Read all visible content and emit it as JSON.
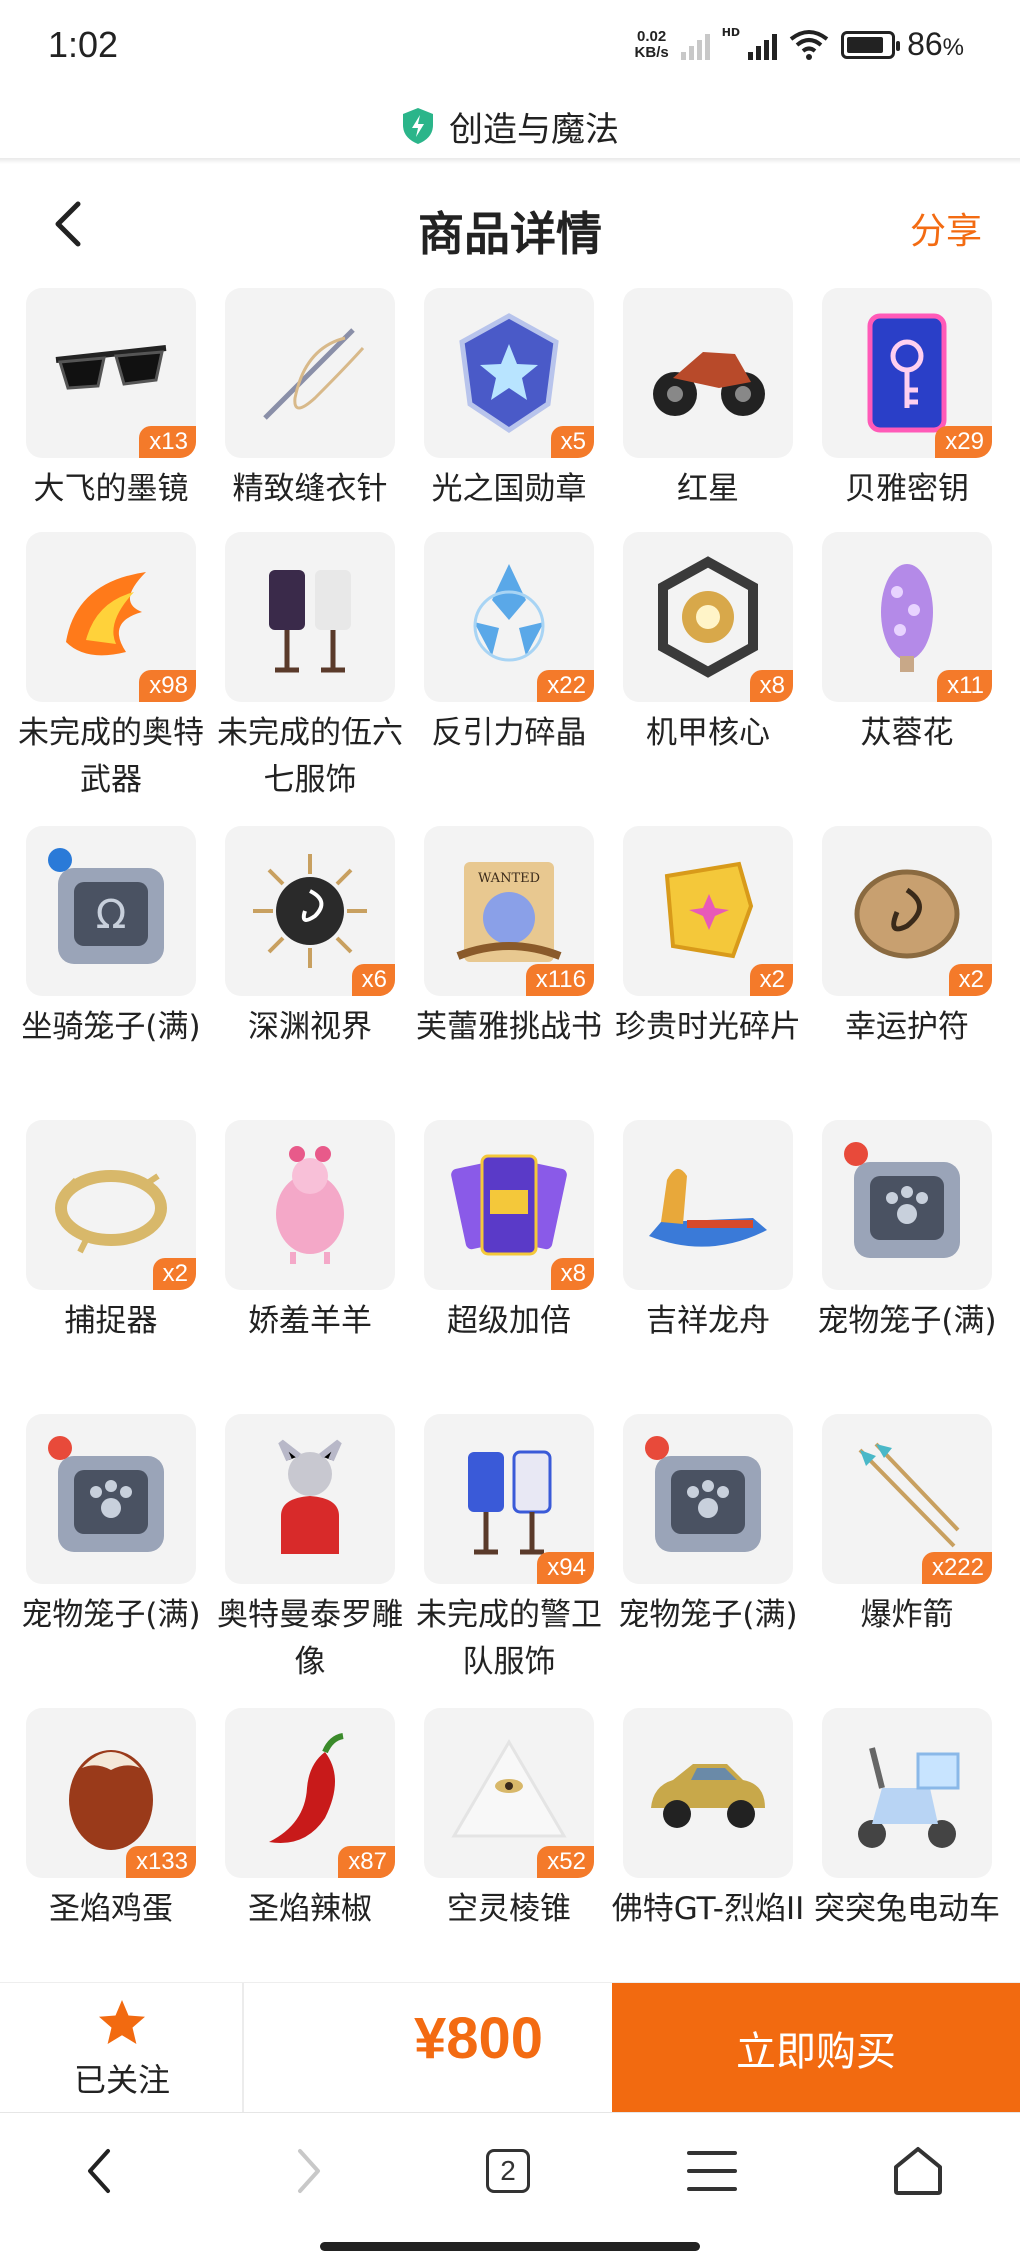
{
  "status_bar": {
    "time": "1:02",
    "net_speed": "0.02",
    "net_unit": "KB/s",
    "hd_label": "HD",
    "battery_percent": "86",
    "battery_suffix": "%"
  },
  "app": {
    "title": "创造与魔法"
  },
  "header": {
    "title": "商品详情",
    "share_label": "分享"
  },
  "items": [
    {
      "name": "大飞的墨镜",
      "qty": "x13",
      "icon": "sunglasses-icon"
    },
    {
      "name": "精致缝衣针",
      "qty": "",
      "icon": "needle-icon"
    },
    {
      "name": "光之国勋章",
      "qty": "x5",
      "icon": "medal-icon"
    },
    {
      "name": "红星",
      "qty": "",
      "icon": "motorcycle-icon"
    },
    {
      "name": "贝雅密钥",
      "qty": "x29",
      "icon": "key-card-icon"
    },
    {
      "name": "未完成的奥特武器",
      "qty": "x98",
      "icon": "flame-weapon-icon"
    },
    {
      "name": "未完成的伍六七服饰",
      "qty": "",
      "icon": "outfit-icon"
    },
    {
      "name": "反引力碎晶",
      "qty": "x22",
      "icon": "crystal-icon"
    },
    {
      "name": "机甲核心",
      "qty": "x8",
      "icon": "mech-core-icon"
    },
    {
      "name": "苁蓉花",
      "qty": "x11",
      "icon": "flower-icon"
    },
    {
      "name": "坐骑笼子(满)",
      "qty": "",
      "icon": "mount-cage-icon"
    },
    {
      "name": "深渊视界",
      "qty": "x6",
      "icon": "abyss-sun-icon"
    },
    {
      "name": "芙蕾雅挑战书",
      "qty": "x116",
      "icon": "wanted-scroll-icon"
    },
    {
      "name": "珍贵时光碎片",
      "qty": "x2",
      "icon": "time-shard-icon"
    },
    {
      "name": "幸运护符",
      "qty": "x2",
      "icon": "amulet-icon"
    },
    {
      "name": "捕捉器",
      "qty": "x2",
      "icon": "catcher-icon"
    },
    {
      "name": "娇羞羊羊",
      "qty": "",
      "icon": "pink-sheep-icon"
    },
    {
      "name": "超级加倍",
      "qty": "x8",
      "icon": "cards-icon"
    },
    {
      "name": "吉祥龙舟",
      "qty": "",
      "icon": "dragon-boat-icon"
    },
    {
      "name": "宠物笼子(满)",
      "qty": "",
      "icon": "pet-cage-icon"
    },
    {
      "name": "宠物笼子(满)",
      "qty": "",
      "icon": "pet-cage-icon"
    },
    {
      "name": "奥特曼泰罗雕像",
      "qty": "",
      "icon": "statue-icon"
    },
    {
      "name": "未完成的警卫队服饰",
      "qty": "x94",
      "icon": "guard-outfit-icon"
    },
    {
      "name": "宠物笼子(满)",
      "qty": "",
      "icon": "pet-cage-icon"
    },
    {
      "name": "爆炸箭",
      "qty": "x222",
      "icon": "arrows-icon"
    },
    {
      "name": "圣焰鸡蛋",
      "qty": "x133",
      "icon": "egg-icon"
    },
    {
      "name": "圣焰辣椒",
      "qty": "x87",
      "icon": "chili-icon"
    },
    {
      "name": "空灵棱锥",
      "qty": "x52",
      "icon": "pyramid-icon"
    },
    {
      "name": "佛特GT-烈焰II",
      "qty": "",
      "icon": "car-icon"
    },
    {
      "name": "突突兔电动车",
      "qty": "",
      "icon": "scooter-icon"
    }
  ],
  "bottom_bar": {
    "follow_label": "已关注",
    "price": "¥800",
    "buy_label": "立即购买"
  },
  "browser_nav": {
    "tab_count": "2"
  },
  "colors": {
    "accent": "#f26a10",
    "qty_badge": "#f47a2a",
    "thumb_bg": "#f3f3f3"
  }
}
